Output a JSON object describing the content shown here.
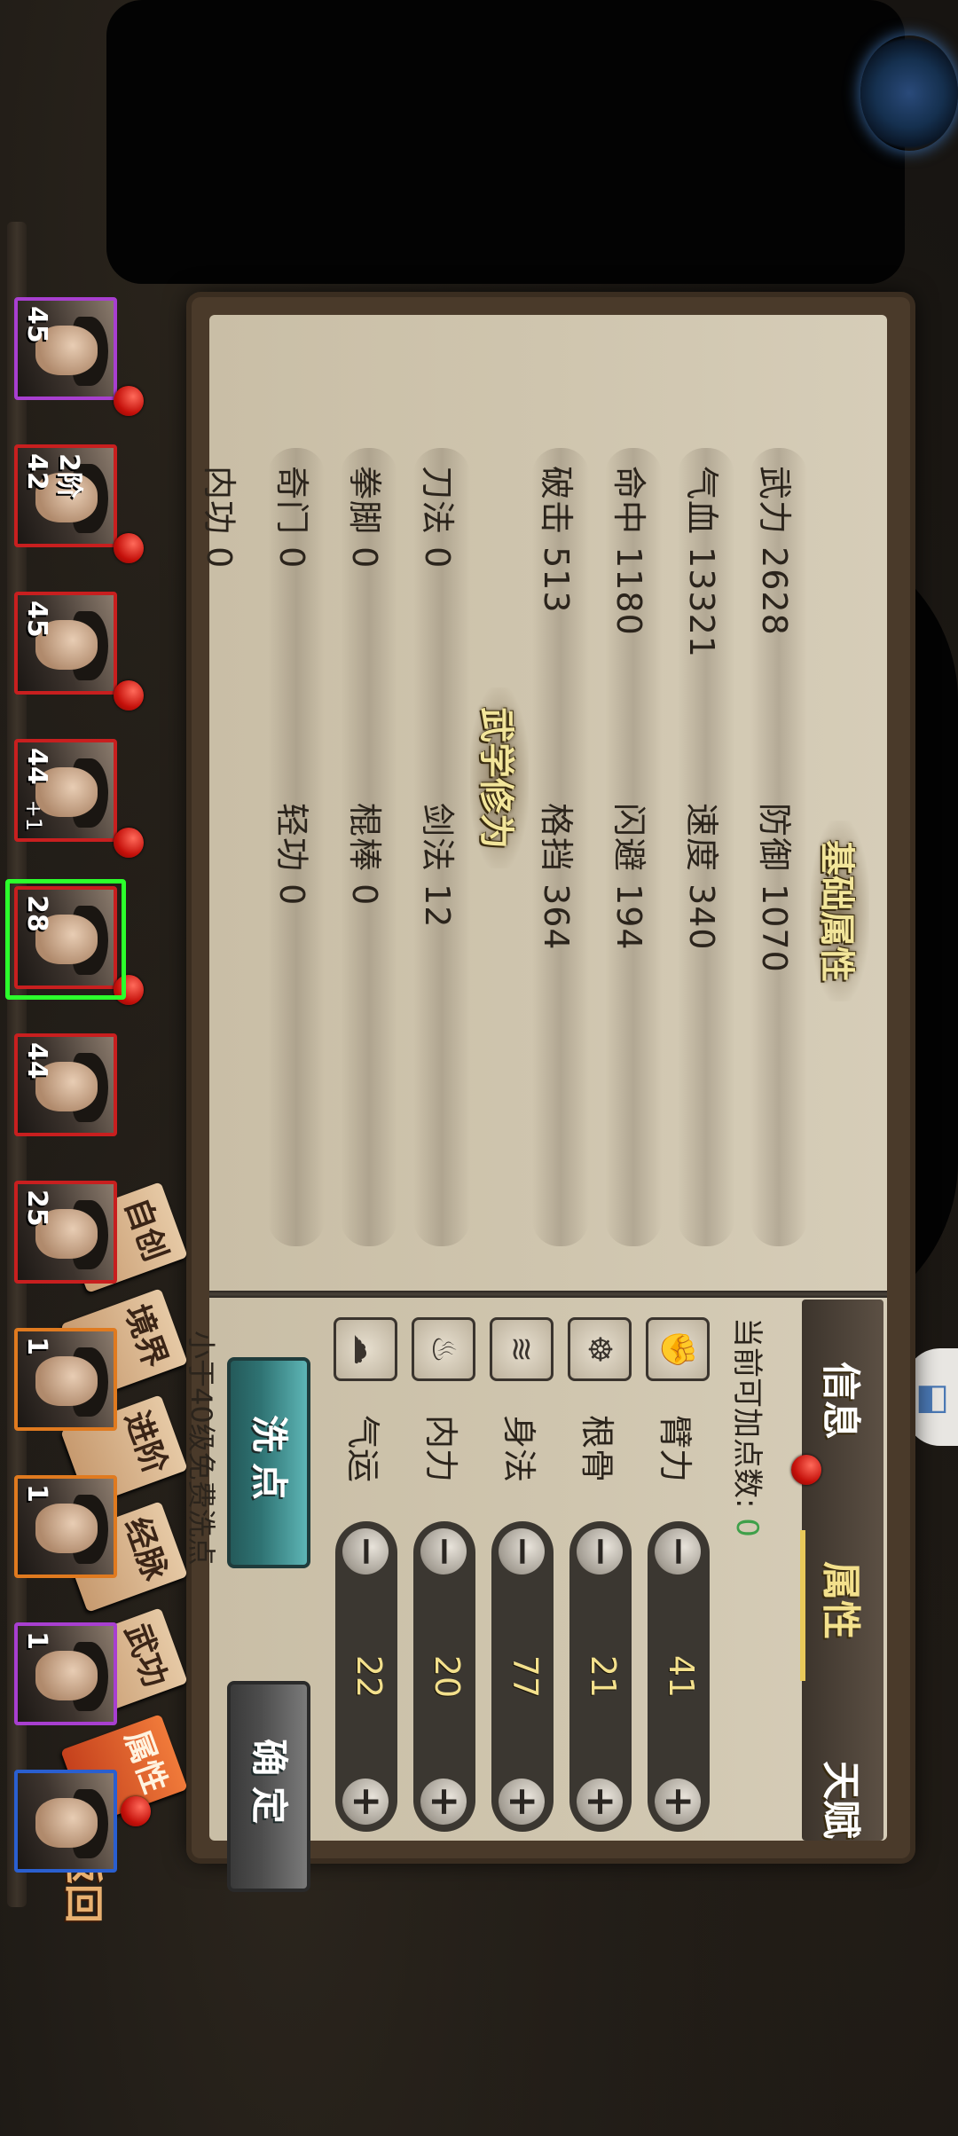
{
  "tabs": {
    "info": "信息",
    "attributes": "属性",
    "talent": "天赋"
  },
  "base_section_title": "基础属性",
  "martial_section_title": "武学修为",
  "base_stats": [
    {
      "label": "武力 2628"
    },
    {
      "label": "防御 1070"
    },
    {
      "label": "气血 13321"
    },
    {
      "label": "速度 340"
    },
    {
      "label": "命中 1180"
    },
    {
      "label": "闪避 194"
    },
    {
      "label": "破击 513"
    },
    {
      "label": "格挡 364"
    }
  ],
  "martial_stats": [
    {
      "label": "刀法 0"
    },
    {
      "label": "剑法 12"
    },
    {
      "label": "拳脚 0"
    },
    {
      "label": "棍棒 0"
    },
    {
      "label": "奇门 0"
    },
    {
      "label": "轻功 0"
    },
    {
      "label": "内功 0"
    }
  ],
  "points": {
    "label": "当前可加点数:",
    "value": "0"
  },
  "attributes": [
    {
      "name": "臂力",
      "value": "41",
      "icon": "arm-icon"
    },
    {
      "name": "根骨",
      "value": "21",
      "icon": "bone-icon"
    },
    {
      "name": "身法",
      "value": "77",
      "icon": "agility-icon"
    },
    {
      "name": "内力",
      "value": "20",
      "icon": "inner-force-icon"
    },
    {
      "name": "气运",
      "value": "22",
      "icon": "luck-icon"
    }
  ],
  "buttons": {
    "wash": "洗点",
    "confirm": "确定"
  },
  "note": "小于40级免费洗点",
  "nav_tags": [
    "属性",
    "武功",
    "经脉",
    "进阶",
    "境界",
    "自创"
  ],
  "back_label": "返回",
  "heroes": [
    {
      "level": "45",
      "frame": "#a83fd0"
    },
    {
      "level": "2阶 42",
      "frame": "#c81f1f"
    },
    {
      "level": "45",
      "frame": "#c81f1f"
    },
    {
      "level": "44",
      "plus": "+1",
      "frame": "#c81f1f"
    },
    {
      "level": "28",
      "frame": "#c81f1f",
      "selected": true
    },
    {
      "level": "44",
      "frame": "#c81f1f"
    },
    {
      "level": "25",
      "frame": "#c81f1f"
    },
    {
      "level": "1",
      "frame": "#e07a1f"
    },
    {
      "level": "1",
      "frame": "#e07a1f"
    },
    {
      "level": "1",
      "frame": "#a83fd0"
    },
    {
      "level": "",
      "frame": "#2a5fd0"
    }
  ]
}
